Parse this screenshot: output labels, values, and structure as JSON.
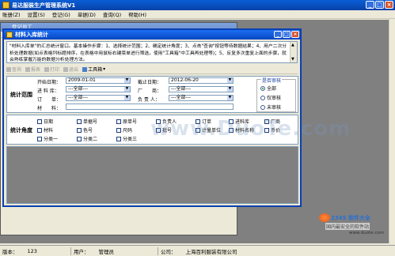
{
  "window": {
    "title": "易达服装生产管理系统V1"
  },
  "menu": [
    "账册(Z)",
    "设置(S)",
    "登记(G)",
    "单据(D)",
    "查询(Q)",
    "帮助(H)"
  ],
  "child_back": {
    "title": "登记员工"
  },
  "dialog": {
    "title": "材料入库统计",
    "info_text": "\"材料入库单\"的汇总统计窗口。基本操作步骤：1、选择统计范围；2、确定统计角度；3、点击\"查询\"按钮等待数据结果；4、用户二次分析处理数据(如点表格列标题排序，在表格中用鼠标右键菜单进行筛选，使用\"工具箱\"中工具再处理等)；5、反复多次重复上面的步骤，就会熟练掌握万能的数据分析处理方法。",
    "toolbar": [
      {
        "label": "查询",
        "enabled": false
      },
      {
        "label": "报表",
        "enabled": false
      },
      {
        "label": "打印",
        "enabled": false
      },
      {
        "label": "退出",
        "enabled": false
      },
      {
        "label": "工具箱",
        "enabled": true
      }
    ],
    "range": {
      "section_label": "统计范围",
      "start_date_label": "开始日期：",
      "start_date": "2009-01-01",
      "end_date_label": "截止日期：",
      "end_date": "2012-06-20",
      "warehouse_label": "进 料 库：",
      "warehouse_value": "---全部---",
      "factory_label": "厂　　商：",
      "factory_value": "---全部---",
      "order_label": "订　　单：",
      "order_value": "---全部---",
      "person_label": "负 责 人：",
      "person_value": "---全部---",
      "material_label": "材　　料：",
      "audit": {
        "legend": "是否审核",
        "options": [
          "全部",
          "仅审核",
          "未审核"
        ],
        "selected": "全部"
      }
    },
    "angle": {
      "section_label": "统计角度",
      "rows": [
        [
          "日期",
          "单据号",
          "原单号",
          "负责人",
          "订单",
          "进料库",
          "厂商"
        ],
        [
          "材料",
          "色号",
          "尺码",
          "批号",
          "计量单位",
          "材料名称",
          "币价"
        ],
        [
          "分类一",
          "分类二",
          "分类三"
        ]
      ]
    }
  },
  "watermark": "www.DuoTe.com",
  "logo": {
    "text": "2345",
    "sub": "软件大全",
    "sub2": "国内最安全的软件站",
    "url": "www.duote.com"
  },
  "status": {
    "version_label": "版本：",
    "version_value": "123",
    "user_label": "用户：",
    "user_value": "管理员",
    "company_label": "公司：",
    "company_value": "上海百利服装有限公司"
  }
}
